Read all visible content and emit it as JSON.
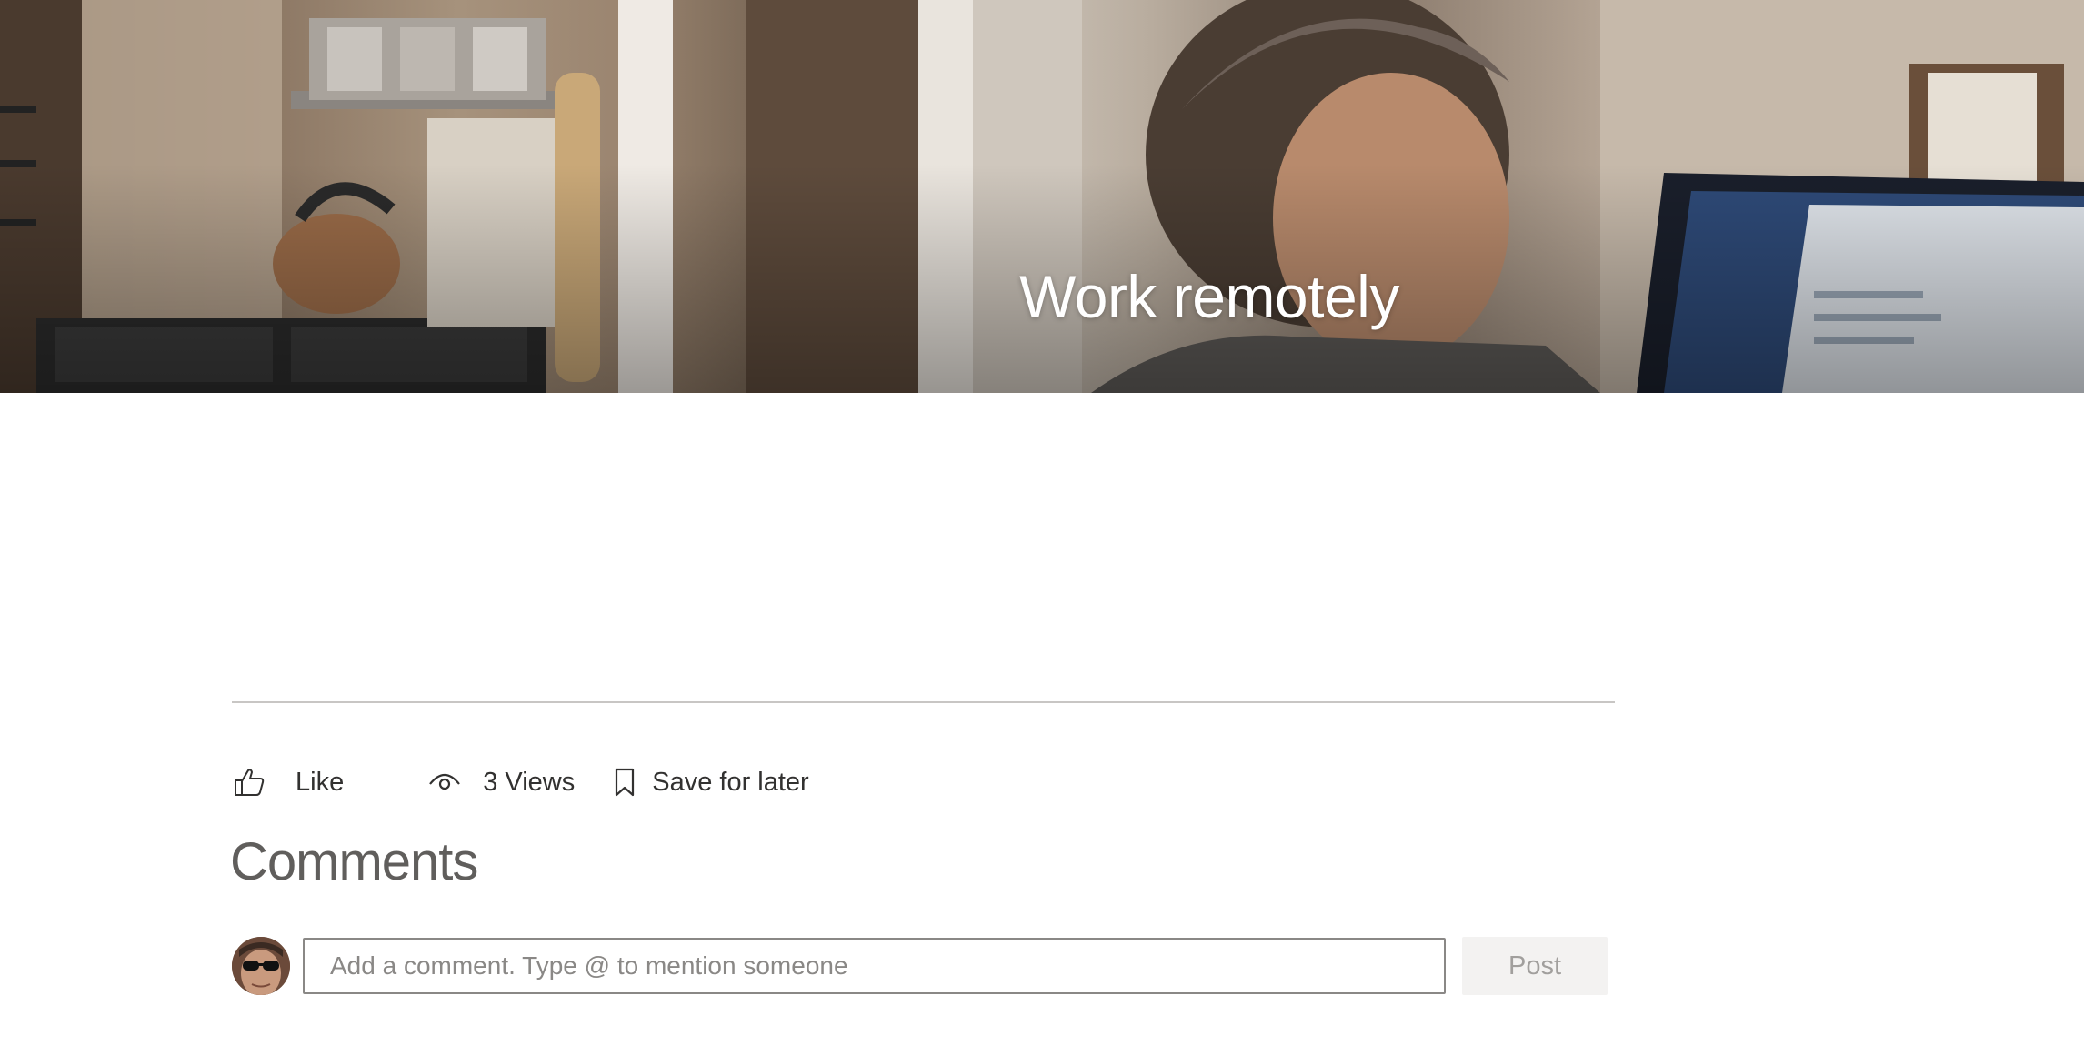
{
  "hero": {
    "title": "Work remotely",
    "image": "man-working-at-laptop-in-kitchen-photo"
  },
  "actions": {
    "like_label": "Like",
    "views_label": "3 Views",
    "save_label": "Save for later"
  },
  "comments": {
    "title": "Comments",
    "input_placeholder": "Add a comment. Type @ to mention someone",
    "input_value": "",
    "post_label": "Post"
  },
  "icons": {
    "like": "thumbs-up-icon",
    "views": "eye-icon",
    "save": "bookmark-icon"
  },
  "colors": {
    "text": "#323130",
    "muted": "#605e5c",
    "divider": "#c8c6c4",
    "input_border": "#8a8886",
    "post_bg": "#f3f2f1",
    "post_text": "#a19f9d"
  }
}
